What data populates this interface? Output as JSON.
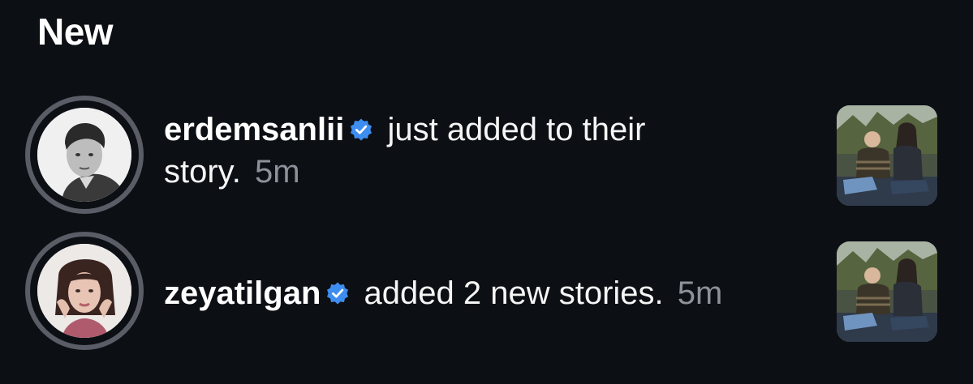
{
  "section": {
    "title": "New"
  },
  "notifications": [
    {
      "username": "erdemsanlii",
      "verified": true,
      "message_part1": "just added to their",
      "message_part2": "story.",
      "time": "5m",
      "avatar_icon": "man-portrait-avatar",
      "thumbnail_icon": "story-photo-thumbnail"
    },
    {
      "username": "zeyatilgan",
      "verified": true,
      "message": "added 2 new stories.",
      "time": "5m",
      "avatar_icon": "woman-portrait-avatar",
      "thumbnail_icon": "story-photo-thumbnail"
    }
  ],
  "colors": {
    "background": "#0c0f14",
    "text": "#f5f5f5",
    "muted": "#8e9199",
    "verified_blue": "#3d8ef0",
    "story_ring": "#5a5d66"
  }
}
